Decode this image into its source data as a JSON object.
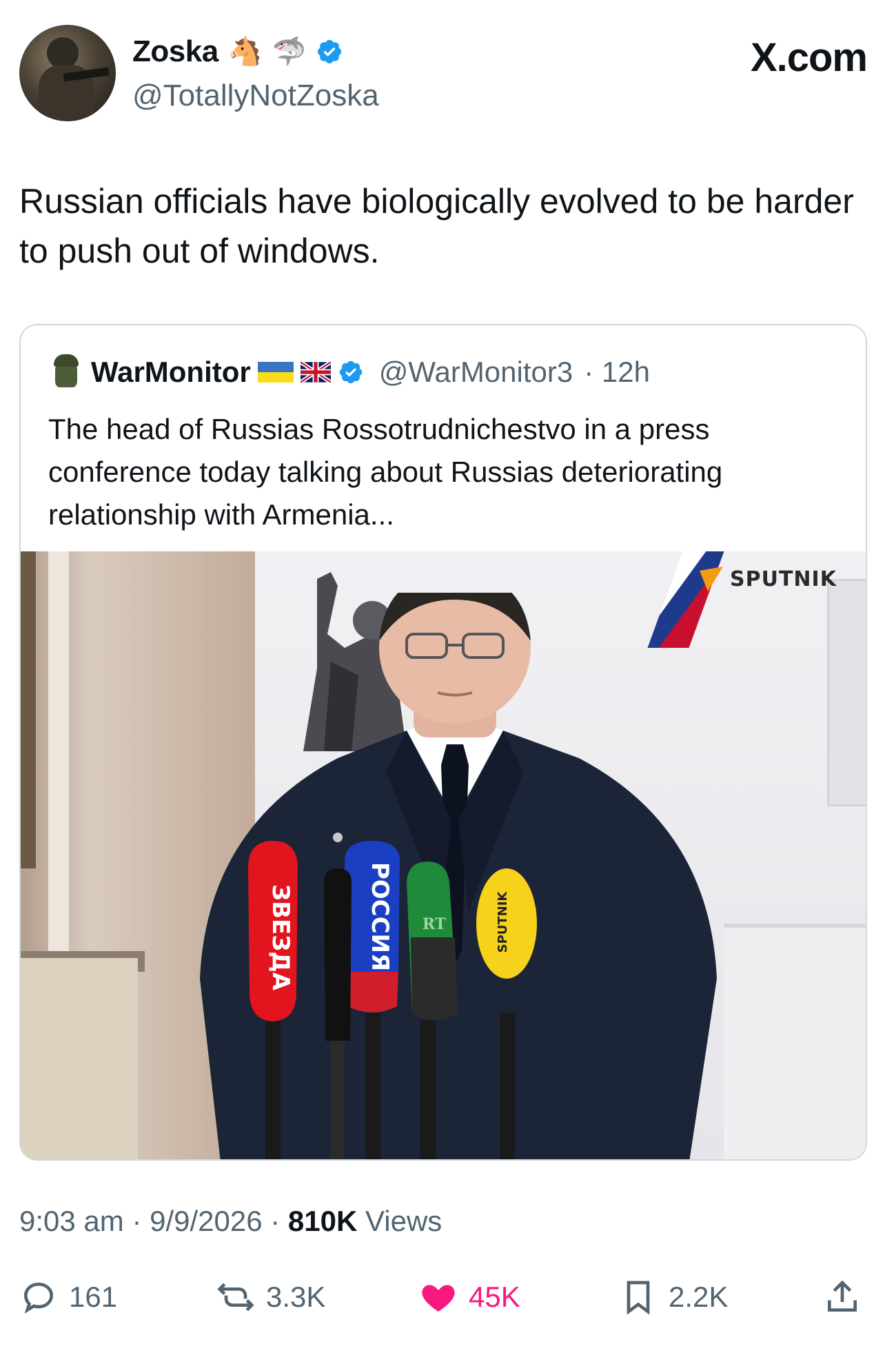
{
  "author": {
    "display_name": "Zoska",
    "emoji_1": "🐴",
    "emoji_2": "🦈",
    "handle": "@TotallyNotZoska",
    "verified": true
  },
  "brand": "X.com",
  "tweet": {
    "text": "Russian officials have biologically evolved to be harder to push out of windows."
  },
  "quoted_tweet": {
    "display_name": "WarMonitor",
    "handle": "@WarMonitor3",
    "age": "· 12h",
    "verified": true,
    "text": "The head of Russias Rossotrudnichestvo  in a press conference today talking about Russias deteriorating relationship with Armenia...",
    "media": {
      "watermark": "SPUTNIK",
      "microphones": [
        "ЗВЕЗДА",
        "РОССИЯ",
        "RT",
        "SPUTNIK"
      ]
    }
  },
  "meta": {
    "time": "9:03 am",
    "date": "· 9/9/2026 ·",
    "views_count": "810K",
    "views_label": "Views"
  },
  "actions": {
    "replies": "161",
    "reposts": "3.3K",
    "likes": "45K",
    "bookmarks": "2.2K"
  },
  "colors": {
    "verified": "#1d9bf0",
    "like": "#f91880",
    "secondary_text": "#536471",
    "border": "#cfd9de"
  }
}
